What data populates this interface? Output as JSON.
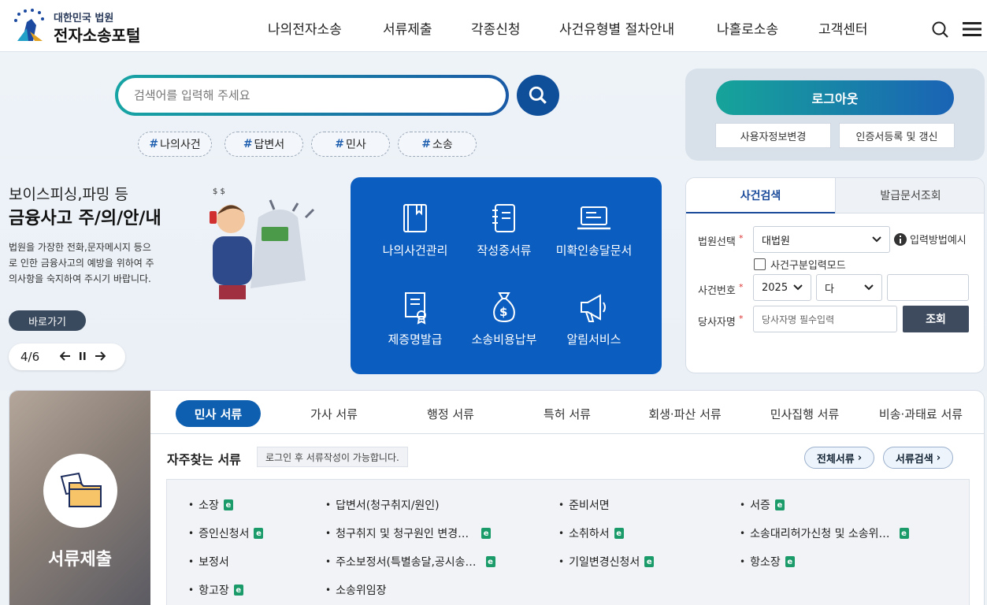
{
  "header": {
    "logo_sub": "대한민국 법원",
    "logo_main": "전자소송포털",
    "nav": [
      "나의전자소송",
      "서류제출",
      "각종신청",
      "사건유형별 절차안내",
      "나홀로소송",
      "고객센터"
    ]
  },
  "search": {
    "placeholder": "검색어를 입력해 주세요",
    "tags": [
      "나의사건",
      "답변서",
      "민사",
      "소송"
    ]
  },
  "login": {
    "logout": "로그아웃",
    "profile_change": "사용자정보변경",
    "cert": "인증서등록 및 갱신"
  },
  "promo": {
    "line1": "보이스피싱,파밍 등",
    "line2": "금융사고 주/의/안/내",
    "desc": "법원을 가장한 전화,문자메시지 등으로 인한 금융사고의 예방을 위하여 주의사항을 숙지하여 주시기 바랍니다.",
    "go": "바로가기",
    "counter": "4/6"
  },
  "quick_menu": [
    {
      "label": "나의사건관리",
      "icon": "book-icon"
    },
    {
      "label": "작성중서류",
      "icon": "notebook-icon"
    },
    {
      "label": "미확인송달문서",
      "icon": "laptop-icon"
    },
    {
      "label": "제증명발급",
      "icon": "certificate-icon"
    },
    {
      "label": "소송비용납부",
      "icon": "money-bag-icon"
    },
    {
      "label": "알림서비스",
      "icon": "megaphone-icon"
    }
  ],
  "case_search": {
    "tab_active": "사건검색",
    "tab_other": "발급문서조회",
    "court_label": "법원선택",
    "court_value": "대법원",
    "help": "입력방법예시",
    "mode_check": "사건구분입력모드",
    "case_no_label": "사건번호",
    "year": "2025",
    "type": "다",
    "party_label": "당사자명",
    "party_placeholder": "당사자명 필수입력",
    "submit": "조회"
  },
  "docs": {
    "side_title": "서류제출",
    "tabs": [
      "민사 서류",
      "가사 서류",
      "행정 서류",
      "특허 서류",
      "회생·파산 서류",
      "민사집행 서류",
      "비송·과태료 서류"
    ],
    "freq_title": "자주찾는 서류",
    "freq_note": "로그인 후 서류작성이 가능합니다.",
    "all_docs": "전체서류",
    "doc_search": "서류검색",
    "items": [
      [
        "소장",
        "답변서(청구취지/원인)",
        "준비서면",
        "서증"
      ],
      [
        "증인신청서",
        "청구취지 및 청구원인 변경…",
        "소취하서",
        "소송대리허가신청 및 소송위…"
      ],
      [
        "보정서",
        "주소보정서(특별송달,공시송…",
        "기일변경신청서",
        "항소장"
      ],
      [
        "항고장",
        "소송위임장"
      ]
    ],
    "e_icon": "e"
  },
  "colors": {
    "primary": "#0b5dc0",
    "teal": "#16a49a",
    "dark": "#3a4a5e"
  }
}
